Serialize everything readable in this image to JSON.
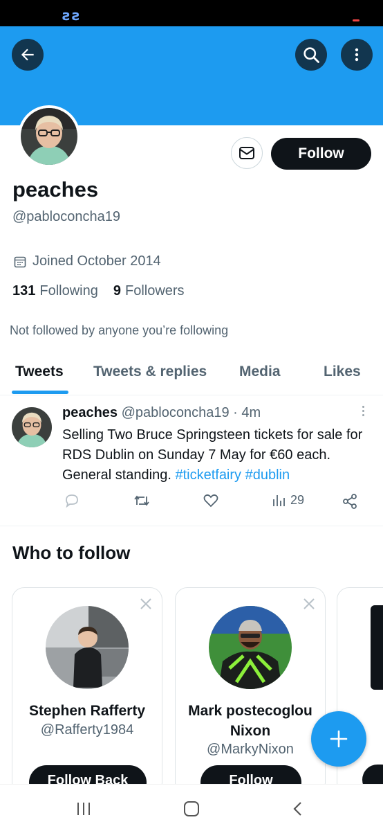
{
  "status_bar": {
    "logo": "ꙅꙅ"
  },
  "header": {
    "icons": [
      "back-arrow-icon",
      "search-icon",
      "more-vertical-icon"
    ]
  },
  "profile": {
    "display_name": "peaches",
    "handle": "@pabloconcha19",
    "follow_label": "Follow",
    "joined": "Joined October 2014",
    "following_count": "131",
    "following_label": "Following",
    "followers_count": "9",
    "followers_label": "Followers",
    "not_followed": "Not followed by anyone you’re following"
  },
  "tabs": [
    {
      "label": "Tweets",
      "active": true
    },
    {
      "label": "Tweets & replies"
    },
    {
      "label": "Media"
    },
    {
      "label": "Likes"
    }
  ],
  "tweet": {
    "name": "peaches",
    "meta": "@pabloconcha19 · 4m",
    "text": "Selling Two Bruce Springsteen tickets for sale for RDS Dublin on Sunday 7 May for €60 each. General standing.",
    "hashtags": [
      "#ticketfairy",
      "#dublin"
    ],
    "views": "29"
  },
  "who_to_follow": {
    "title": "Who to follow",
    "cards": [
      {
        "name": "Stephen Rafferty",
        "handle": "@Rafferty1984",
        "button": "Follow Back"
      },
      {
        "name": "Mark postecoglou Nixon",
        "handle": "@MarkyNixon",
        "button": "Follow"
      }
    ]
  },
  "colors": {
    "accent": "#1d9bf0",
    "text": "#0f1419",
    "secondary": "#536471"
  }
}
